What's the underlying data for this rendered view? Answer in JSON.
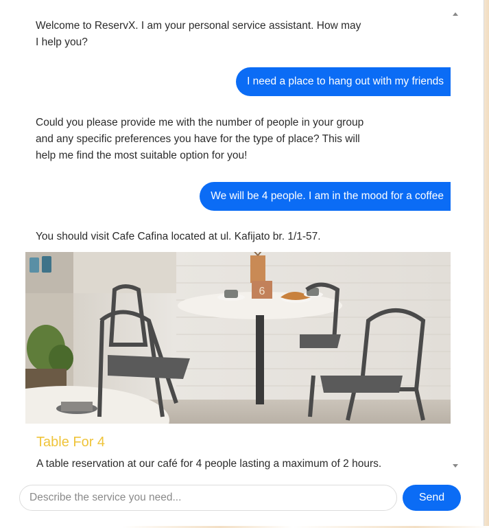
{
  "messages": [
    {
      "role": "bot",
      "text": "Welcome to ReservX. I am your personal service assistant. How may I help you?"
    },
    {
      "role": "user",
      "text": "I need a place to hang out with my friends"
    },
    {
      "role": "bot",
      "text": "Could you please provide me with the number of people in your group and any specific preferences you have for the type of place? This will help me find the most suitable option for you!"
    },
    {
      "role": "user",
      "text": "We will be 4 people. I am in the mood for a coffee"
    },
    {
      "role": "bot",
      "text": "You should visit Cafe Cafina located at ul. Kafijato br. 1/1-57."
    }
  ],
  "card": {
    "title": "Table For 4",
    "description": "A table reservation at our café for 4 people lasting a maximum of 2 hours.",
    "table_number": "6"
  },
  "composer": {
    "placeholder": "Describe the service you need...",
    "send_label": "Send"
  },
  "colors": {
    "accent": "#0b6cf5",
    "card_title": "#efc43a"
  }
}
